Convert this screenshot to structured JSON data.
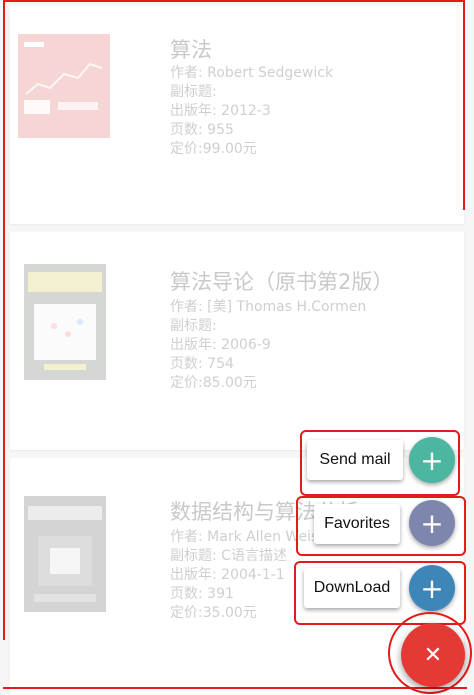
{
  "books": [
    {
      "title": "算法",
      "author": "作者: Robert Sedgewick",
      "subtitle": "副标题:",
      "published": "出版年: 2012-3",
      "pages": "页数: 955",
      "price": "定价:99.00元",
      "cover_icon": "book-cover-algorithms"
    },
    {
      "title": "算法导论（原书第2版）",
      "author": "作者: [美] Thomas H.Cormen",
      "subtitle": "副标题:",
      "published": "出版年: 2006-9",
      "pages": "页数: 754",
      "price": "定价:85.00元",
      "cover_icon": "book-cover-introduction-to-algorithms"
    },
    {
      "title": "数据结构与算法分析",
      "author": "作者: Mark Allen Weiss",
      "subtitle": "副标题: C语言描述",
      "published": "出版年: 2004-1-1",
      "pages": "页数: 391",
      "price": "定价:35.00元",
      "cover_icon": "book-cover-data-structures"
    }
  ],
  "speed_dial": {
    "actions": [
      {
        "label": "Send mail",
        "icon": "plus-icon",
        "color": "#4db6a0"
      },
      {
        "label": "Favorites",
        "icon": "plus-icon",
        "color": "#7f86ad"
      },
      {
        "label": "DownLoad",
        "icon": "plus-icon",
        "color": "#3f86b8"
      }
    ],
    "main": {
      "icon": "close-icon",
      "color": "#e53935"
    }
  },
  "colors": {
    "annotation": "#e21b1b"
  }
}
